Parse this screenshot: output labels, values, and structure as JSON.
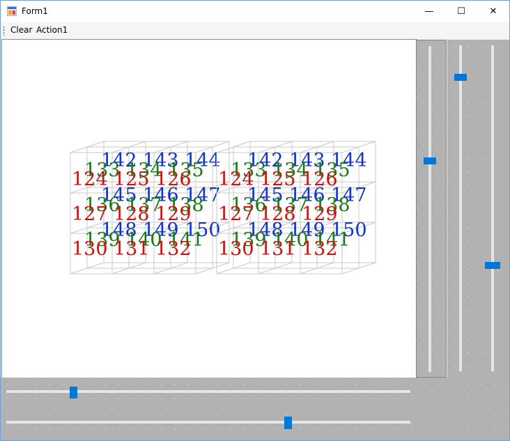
{
  "window": {
    "title": "Form1",
    "controls": {
      "minimize": "—",
      "maximize": "☐",
      "close": "✕"
    }
  },
  "menu": {
    "items": [
      "Clear",
      "Action1"
    ]
  },
  "scene": {
    "colors": {
      "front": "#cc1111",
      "middle": "#1a7a1a",
      "back": "#1133cc",
      "grid": "#c8c8c8"
    },
    "layers": [
      {
        "name": "back",
        "rows": [
          [
            "142",
            "143",
            "144"
          ],
          [
            "145",
            "146",
            "147"
          ],
          [
            "148",
            "149",
            "150"
          ]
        ]
      },
      {
        "name": "middle",
        "rows": [
          [
            "133",
            "134",
            "135"
          ],
          [
            "136",
            "137",
            "138"
          ],
          [
            "139",
            "140",
            "141"
          ]
        ]
      },
      {
        "name": "front",
        "rows": [
          [
            "124",
            "125",
            "126"
          ],
          [
            "127",
            "128",
            "129"
          ],
          [
            "130",
            "131",
            "132"
          ]
        ]
      }
    ],
    "groups": 2
  },
  "trackbars": {
    "vertical": [
      {
        "value_fraction": 0.35
      },
      {
        "value_fraction": 0.09
      },
      {
        "value_fraction": 0.68
      }
    ],
    "horizontal": [
      {
        "value_fraction": 0.16
      },
      {
        "value_fraction": 0.7
      }
    ]
  }
}
